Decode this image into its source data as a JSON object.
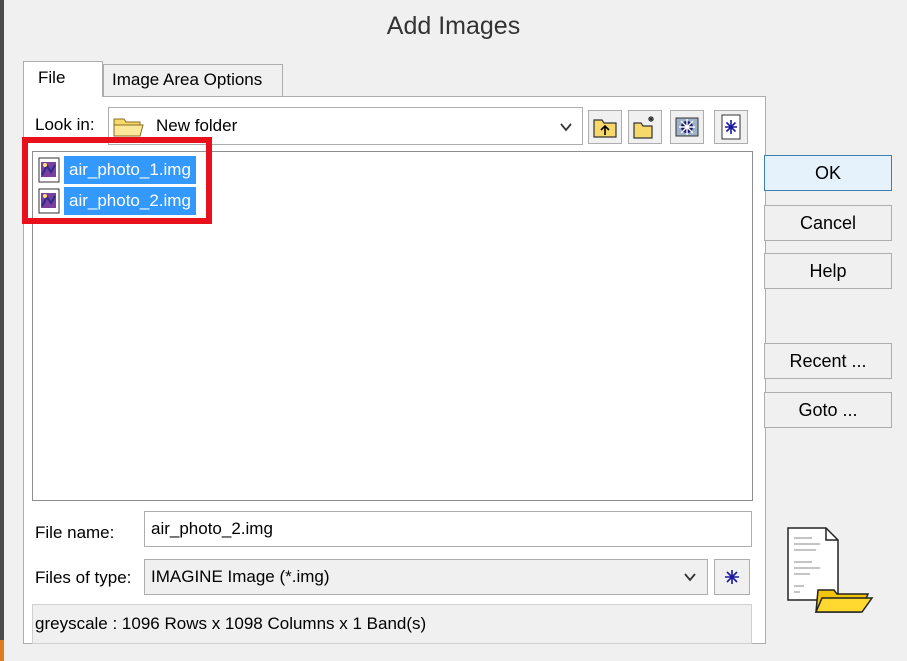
{
  "window": {
    "title": "Add Images"
  },
  "tabs": [
    {
      "label": "File",
      "active": true
    },
    {
      "label": "Image Area Options",
      "active": false
    }
  ],
  "look_in": {
    "label": "Look in:",
    "value": "New folder"
  },
  "toolbar_icons": [
    "up-folder-icon",
    "new-folder-icon",
    "gear-icon",
    "asterisk-icon"
  ],
  "files": [
    {
      "name": "air_photo_1.img",
      "selected": true
    },
    {
      "name": "air_photo_2.img",
      "selected": true
    }
  ],
  "buttons": {
    "ok": "OK",
    "cancel": "Cancel",
    "help": "Help",
    "recent": "Recent ...",
    "goto": "Goto ..."
  },
  "file_name": {
    "label": "File name:",
    "value": "air_photo_2.img"
  },
  "file_type": {
    "label": "Files of type:",
    "value": "IMAGINE Image (*.img)"
  },
  "status": "greyscale : 1096 Rows x 1098 Columns x 1 Band(s)",
  "colors": {
    "selection": "#3399ff",
    "highlight_box": "#e8101b",
    "ok_border": "#3c7fb1"
  }
}
